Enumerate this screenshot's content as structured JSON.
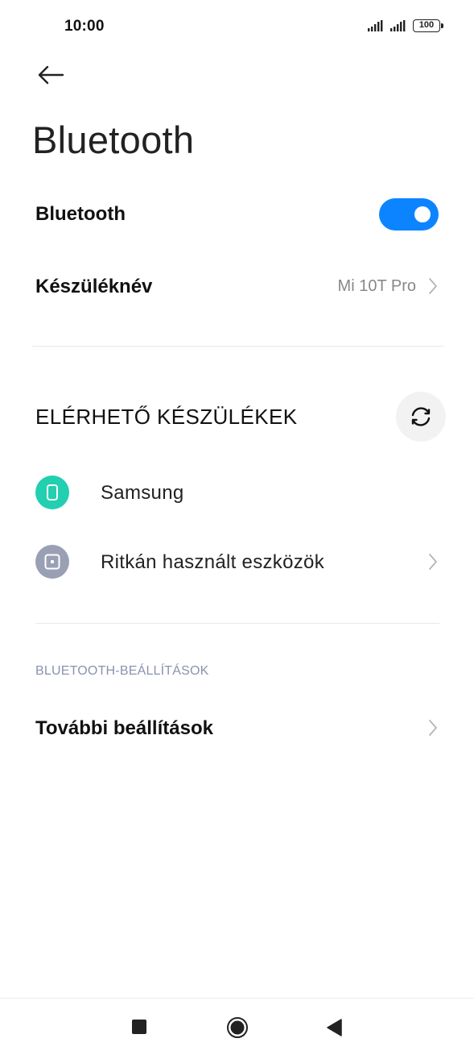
{
  "status_bar": {
    "time": "10:00",
    "battery": "100"
  },
  "header": {
    "back_icon": "arrow-left-icon",
    "title": "Bluetooth"
  },
  "bluetooth_toggle": {
    "label": "Bluetooth",
    "enabled": true,
    "color": "#0d84ff"
  },
  "device_name": {
    "label": "Készüléknév",
    "value": "Mi 10T Pro"
  },
  "available_devices": {
    "heading": "ELÉRHETŐ KÉSZÜLÉKEK",
    "refresh_icon": "refresh-icon",
    "items": [
      {
        "label": "Samsung",
        "icon": "phone-icon",
        "icon_color": "#22cfb0"
      },
      {
        "label": "Ritkán használt eszközök",
        "icon": "device-box-icon",
        "icon_color": "#9aa0b4"
      }
    ]
  },
  "bluetooth_settings": {
    "heading": "BLUETOOTH-BEÁLLÍTÁSOK",
    "more_label": "További beállítások"
  },
  "nav_bar": {
    "recents_icon": "square-icon",
    "home_icon": "circle-icon",
    "back_icon": "triangle-back-icon"
  }
}
